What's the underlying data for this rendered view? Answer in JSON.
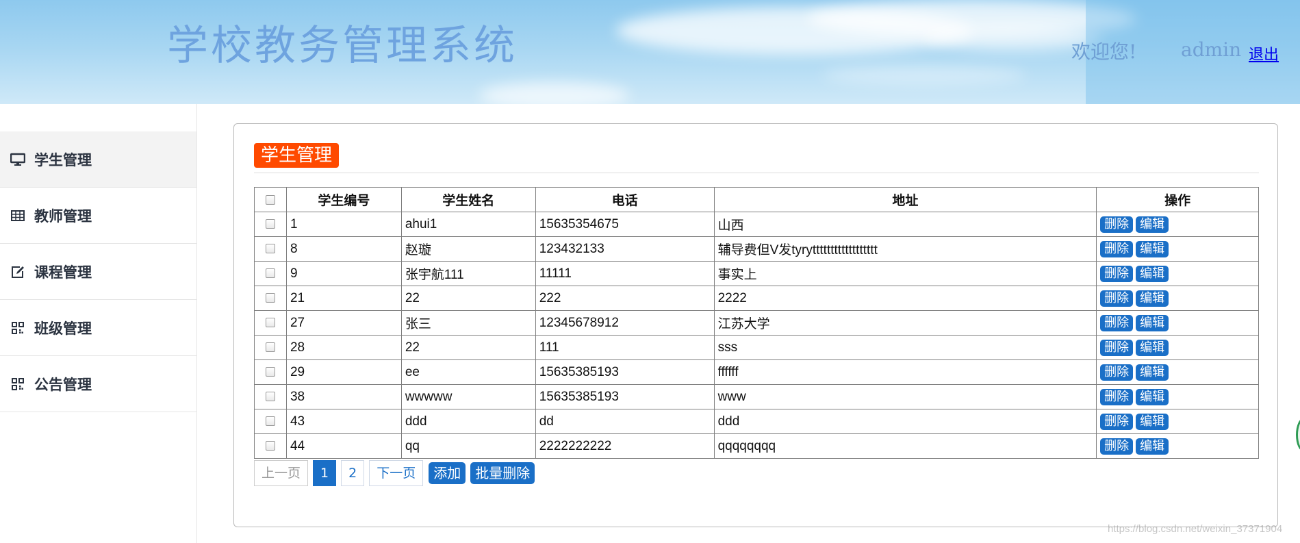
{
  "header": {
    "title": "学校教务管理系统",
    "welcome": "欢迎您!",
    "username": "admin",
    "logout": "退出"
  },
  "sidebar": {
    "items": [
      {
        "label": "学生管理",
        "icon": "monitor-icon",
        "active": true
      },
      {
        "label": "教师管理",
        "icon": "table-icon",
        "active": false
      },
      {
        "label": "课程管理",
        "icon": "edit-icon",
        "active": false
      },
      {
        "label": "班级管理",
        "icon": "qrcode-icon",
        "active": false
      },
      {
        "label": "公告管理",
        "icon": "qrcode-icon",
        "active": false
      }
    ]
  },
  "panel": {
    "title": "学生管理",
    "table": {
      "headers": [
        "学生编号",
        "学生姓名",
        "电话",
        "地址",
        "操作"
      ],
      "rows": [
        {
          "id": "1",
          "name": "ahui1",
          "phone": "15635354675",
          "address": "山西"
        },
        {
          "id": "8",
          "name": "赵璇",
          "phone": "123432133",
          "address": "辅导费但V发tyrytttttttttttttttttt"
        },
        {
          "id": "9",
          "name": "张宇航111",
          "phone": "11111",
          "address": "事实上"
        },
        {
          "id": "21",
          "name": "22",
          "phone": "222",
          "address": "2222"
        },
        {
          "id": "27",
          "name": "张三",
          "phone": "12345678912",
          "address": "江苏大学"
        },
        {
          "id": "28",
          "name": "22",
          "phone": "111",
          "address": "sss"
        },
        {
          "id": "29",
          "name": "ee",
          "phone": "15635385193",
          "address": "ffffff"
        },
        {
          "id": "38",
          "name": "wwwww",
          "phone": "15635385193",
          "address": "www"
        },
        {
          "id": "43",
          "name": "ddd",
          "phone": "dd",
          "address": "ddd"
        },
        {
          "id": "44",
          "name": "qq",
          "phone": "2222222222",
          "address": "qqqqqqqq"
        }
      ],
      "row_actions": {
        "delete": "删除",
        "edit": "编辑"
      }
    },
    "pager": {
      "prev": "上一页",
      "pages": [
        "1",
        "2"
      ],
      "current": "1",
      "next": "下一页"
    },
    "actions": {
      "add": "添加",
      "batch_delete": "批量删除"
    }
  },
  "watermark": "https://blog.csdn.net/weixin_37371904",
  "colors": {
    "accent": "#1a6fc7",
    "title_badge": "#ff4a00",
    "header_title": "#6ea3df"
  }
}
